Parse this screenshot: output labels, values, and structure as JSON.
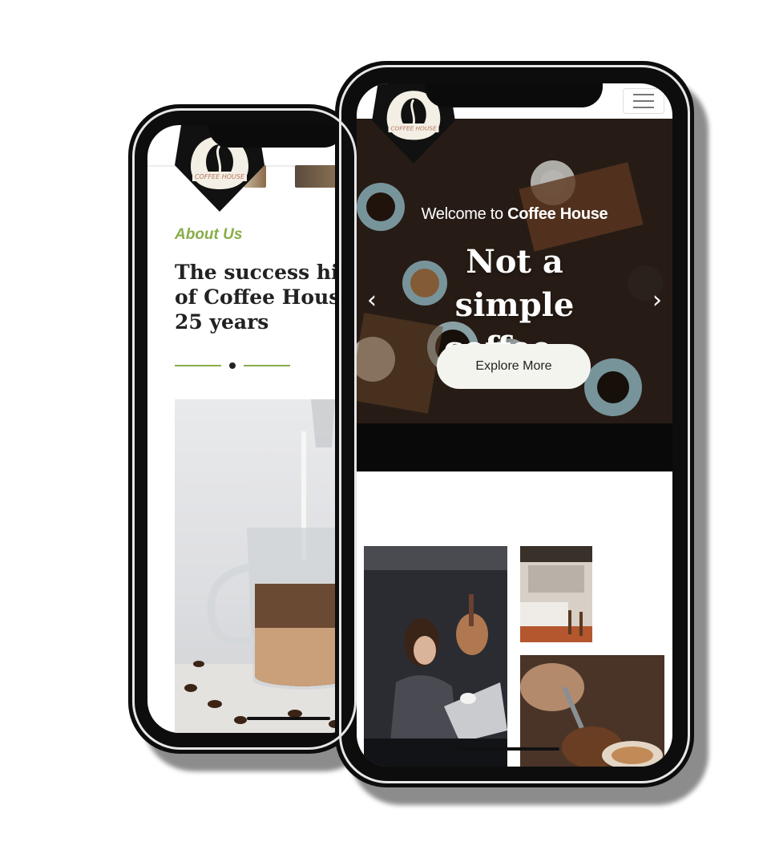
{
  "brand": {
    "logo_text": "COFFEE HOUSE",
    "accent_color": "#88ad4a",
    "dark_color": "#111111"
  },
  "back_phone": {
    "about": {
      "label": "About Us",
      "title": "The success history of Coffee House in 25 years"
    }
  },
  "front_phone": {
    "menu_icon": "hamburger-menu-icon",
    "hero": {
      "welcome_prefix": "Welcome to ",
      "welcome_brand": "Coffee House",
      "headline": "Not a simple coffee...",
      "button_label": "Explore More",
      "prev_icon": "chevron-left-icon",
      "prev_glyph": "‹",
      "next_icon": "chevron-right-icon",
      "next_glyph": "›"
    }
  }
}
